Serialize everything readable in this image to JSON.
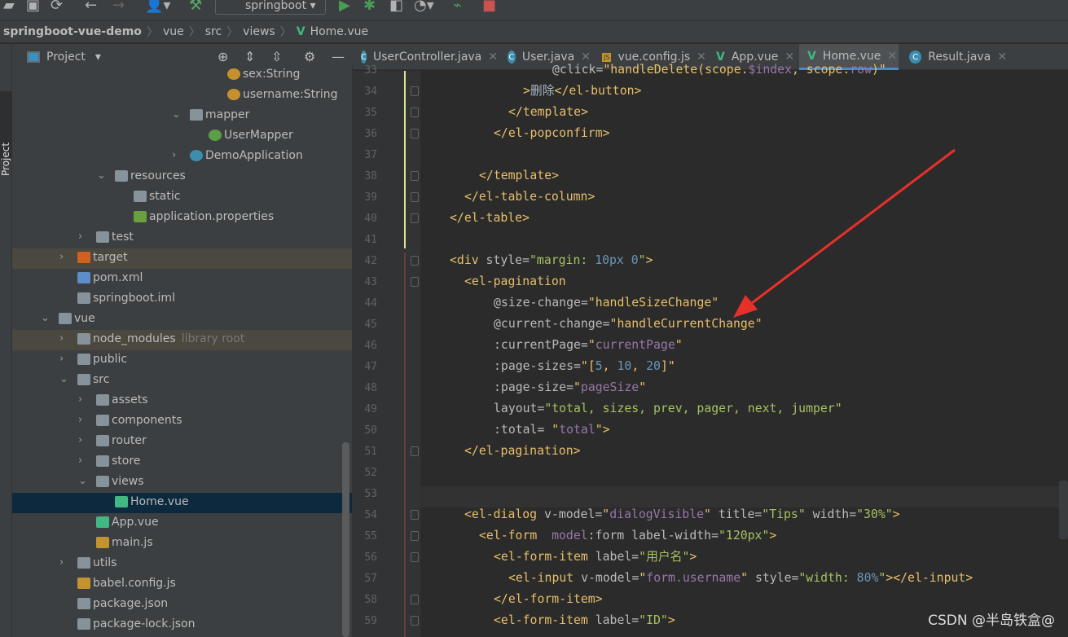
{
  "toolbar": {
    "run_config": "springboot",
    "icons": [
      "open-icon",
      "save-icon",
      "sync-icon",
      "back-icon",
      "forward-icon",
      "user-icon",
      "build-icon",
      "run-icon",
      "debug-icon",
      "coverage-icon",
      "profile-icon",
      "attach-icon",
      "stop-icon"
    ]
  },
  "breadcrumb": [
    "springboot-vue-demo",
    "vue",
    "src",
    "views",
    "Home.vue"
  ],
  "left_strip": {
    "label": "Project"
  },
  "project_header": {
    "title": "Project"
  },
  "tree": [
    {
      "label": "sex:String",
      "depth": 9,
      "icon": "field",
      "leaf": true
    },
    {
      "label": "username:String",
      "depth": 9,
      "icon": "field",
      "leaf": true
    },
    {
      "label": "mapper",
      "depth": 7,
      "icon": "package",
      "expanded": true
    },
    {
      "label": "UserMapper",
      "depth": 8,
      "icon": "interface",
      "leaf": true
    },
    {
      "label": "DemoApplication",
      "depth": 7,
      "icon": "spring-class",
      "expanded": false
    },
    {
      "label": "resources",
      "depth": 3,
      "icon": "resources-folder",
      "expanded": true
    },
    {
      "label": "static",
      "depth": 4,
      "icon": "folder",
      "leaf": true
    },
    {
      "label": "application.properties",
      "depth": 4,
      "icon": "spring-properties",
      "leaf": true
    },
    {
      "label": "test",
      "depth": 2,
      "icon": "folder",
      "expanded": false
    },
    {
      "label": "target",
      "depth": 1,
      "icon": "excluded-folder",
      "expanded": false,
      "highlight": true
    },
    {
      "label": "pom.xml",
      "depth": 1,
      "icon": "maven",
      "leaf": true
    },
    {
      "label": "springboot.iml",
      "depth": 1,
      "icon": "file",
      "leaf": true
    },
    {
      "label": "vue",
      "depth": 0,
      "icon": "folder",
      "expanded": true
    },
    {
      "label": "node_modules",
      "extra": "library root",
      "depth": 1,
      "icon": "folder",
      "expanded": false,
      "highlight": true
    },
    {
      "label": "public",
      "depth": 1,
      "icon": "folder",
      "expanded": false
    },
    {
      "label": "src",
      "depth": 1,
      "icon": "folder",
      "expanded": true
    },
    {
      "label": "assets",
      "depth": 2,
      "icon": "folder",
      "expanded": false
    },
    {
      "label": "components",
      "depth": 2,
      "icon": "folder",
      "expanded": false
    },
    {
      "label": "router",
      "depth": 2,
      "icon": "folder",
      "expanded": false
    },
    {
      "label": "store",
      "depth": 2,
      "icon": "folder",
      "expanded": false
    },
    {
      "label": "views",
      "depth": 2,
      "icon": "folder",
      "expanded": true
    },
    {
      "label": "Home.vue",
      "depth": 3,
      "icon": "vue",
      "leaf": true,
      "selected": true
    },
    {
      "label": "App.vue",
      "depth": 2,
      "icon": "vue",
      "leaf": true
    },
    {
      "label": "main.js",
      "depth": 2,
      "icon": "js",
      "leaf": true
    },
    {
      "label": "utils",
      "depth": 1,
      "icon": "folder",
      "expanded": false
    },
    {
      "label": "babel.config.js",
      "depth": 1,
      "icon": "js",
      "leaf": true
    },
    {
      "label": "package.json",
      "depth": 1,
      "icon": "json",
      "leaf": true
    },
    {
      "label": "package-lock.json",
      "depth": 1,
      "icon": "json",
      "leaf": true
    }
  ],
  "tabs": [
    {
      "label": "UserController.java",
      "icon": "class"
    },
    {
      "label": "User.java",
      "icon": "class"
    },
    {
      "label": "vue.config.js",
      "icon": "js"
    },
    {
      "label": "App.vue",
      "icon": "vue"
    },
    {
      "label": "Home.vue",
      "icon": "vue",
      "active": true
    },
    {
      "label": "Result.java",
      "icon": "class"
    }
  ],
  "code": [
    {
      "n": "33",
      "indent": 18,
      "t": [
        [
          "attr",
          "@click="
        ],
        [
          "js",
          "\"handleDelete(scope."
        ],
        [
          "var",
          "$index"
        ],
        [
          "js",
          ", scope."
        ],
        [
          "var",
          "row"
        ],
        [
          "js",
          ")\""
        ]
      ]
    },
    {
      "n": "34",
      "indent": 14,
      "t": [
        [
          "tag",
          ">"
        ],
        [
          "txt",
          "删除"
        ],
        [
          "tag",
          "</el-button>"
        ]
      ]
    },
    {
      "n": "35",
      "indent": 12,
      "t": [
        [
          "tag",
          "</template>"
        ]
      ]
    },
    {
      "n": "36",
      "indent": 10,
      "t": [
        [
          "tag",
          "</el-popconfirm>"
        ]
      ]
    },
    {
      "n": "37",
      "indent": 0,
      "t": []
    },
    {
      "n": "38",
      "indent": 8,
      "t": [
        [
          "tag",
          "</template>"
        ]
      ]
    },
    {
      "n": "39",
      "indent": 6,
      "t": [
        [
          "tag",
          "</el-table-column>"
        ]
      ]
    },
    {
      "n": "40",
      "indent": 4,
      "t": [
        [
          "tag",
          "</el-table>"
        ]
      ]
    },
    {
      "n": "41",
      "indent": 0,
      "t": []
    },
    {
      "n": "42",
      "indent": 4,
      "t": [
        [
          "tag",
          "<div "
        ],
        [
          "attr",
          "style="
        ],
        [
          "str",
          "\"margin: "
        ],
        [
          "num",
          "10px 0"
        ],
        [
          "str",
          "\""
        ],
        [
          "tag",
          ">"
        ]
      ]
    },
    {
      "n": "43",
      "indent": 6,
      "t": [
        [
          "tag",
          "<el-pagination"
        ]
      ]
    },
    {
      "n": "44",
      "indent": 10,
      "t": [
        [
          "attr",
          "@size-change="
        ],
        [
          "js",
          "\"handleSizeChange\""
        ]
      ]
    },
    {
      "n": "45",
      "indent": 10,
      "t": [
        [
          "attr",
          "@current-change="
        ],
        [
          "js",
          "\"handleCurrentChange\""
        ]
      ]
    },
    {
      "n": "46",
      "indent": 10,
      "t": [
        [
          "attr",
          ":currentPage="
        ],
        [
          "js",
          "\""
        ],
        [
          "var",
          "currentPage"
        ],
        [
          "js",
          "\""
        ]
      ]
    },
    {
      "n": "47",
      "indent": 10,
      "t": [
        [
          "attr",
          ":page-sizes="
        ],
        [
          "js",
          "\"["
        ],
        [
          "num",
          "5"
        ],
        [
          "js",
          ", "
        ],
        [
          "num",
          "10"
        ],
        [
          "js",
          ", "
        ],
        [
          "num",
          "20"
        ],
        [
          "js",
          "]\""
        ]
      ]
    },
    {
      "n": "48",
      "indent": 10,
      "t": [
        [
          "attr",
          ":page-size="
        ],
        [
          "js",
          "\""
        ],
        [
          "var",
          "pageSize"
        ],
        [
          "js",
          "\""
        ]
      ]
    },
    {
      "n": "49",
      "indent": 10,
      "t": [
        [
          "attr",
          "layout="
        ],
        [
          "str",
          "\"total, sizes, prev, pager, next, jumper\""
        ]
      ]
    },
    {
      "n": "50",
      "indent": 10,
      "t": [
        [
          "attr",
          ":total= "
        ],
        [
          "js",
          "\""
        ],
        [
          "var",
          "total"
        ],
        [
          "js",
          "\""
        ],
        [
          "tag",
          ">"
        ]
      ]
    },
    {
      "n": "51",
      "indent": 6,
      "t": [
        [
          "tag",
          "</el-pagination>"
        ]
      ]
    },
    {
      "n": "52",
      "indent": 0,
      "t": []
    },
    {
      "n": "53",
      "indent": 0,
      "t": []
    },
    {
      "n": "54",
      "indent": 6,
      "t": [
        [
          "tag",
          "<el-dialog "
        ],
        [
          "attr",
          "v-model="
        ],
        [
          "js",
          "\""
        ],
        [
          "var",
          "dialogVisible"
        ],
        [
          "js",
          "\""
        ],
        [
          "attr",
          " title="
        ],
        [
          "str",
          "\"Tips\""
        ],
        [
          "attr",
          " width="
        ],
        [
          "str",
          "\"30%\""
        ],
        [
          "tag",
          ">"
        ]
      ]
    },
    {
      "n": "55",
      "indent": 8,
      "t": [
        [
          "tag",
          "<el-form  "
        ],
        [
          "var",
          "model"
        ],
        [
          "attr",
          ":form label-width="
        ],
        [
          "str",
          "\"120px\""
        ],
        [
          "tag",
          ">"
        ]
      ]
    },
    {
      "n": "56",
      "indent": 10,
      "t": [
        [
          "tag",
          "<el-form-item "
        ],
        [
          "attr",
          "label="
        ],
        [
          "str",
          "\"用户名\""
        ],
        [
          "tag",
          ">"
        ]
      ]
    },
    {
      "n": "57",
      "indent": 12,
      "t": [
        [
          "tag",
          "<el-input "
        ],
        [
          "attr",
          "v-model="
        ],
        [
          "js",
          "\""
        ],
        [
          "var",
          "form.username"
        ],
        [
          "js",
          "\""
        ],
        [
          "attr",
          " style="
        ],
        [
          "str",
          "\"width: "
        ],
        [
          "num",
          "80%"
        ],
        [
          "str",
          "\""
        ],
        [
          "tag",
          "></el-input>"
        ]
      ]
    },
    {
      "n": "58",
      "indent": 10,
      "t": [
        [
          "tag",
          "</el-form-item>"
        ]
      ]
    },
    {
      "n": "59",
      "indent": 10,
      "t": [
        [
          "tag",
          "<el-form-item "
        ],
        [
          "attr",
          "label="
        ],
        [
          "str",
          "\"ID\""
        ],
        [
          "tag",
          ">"
        ]
      ]
    }
  ],
  "annotation": {
    "arrow_color": "#e8302b"
  },
  "watermark": "CSDN @半岛铁盒@",
  "colors": {
    "tag": "#e8bf6a",
    "string": "#a5c261",
    "variable": "#9876aa",
    "number": "#6897bb",
    "selection": "#0d293e",
    "accent": "#4a88c7"
  }
}
